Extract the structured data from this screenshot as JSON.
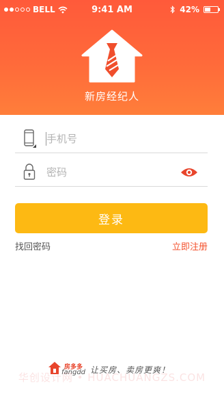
{
  "status_bar": {
    "carrier": "BELL",
    "time": "9:41 AM",
    "battery": "42%",
    "battery_level": 0.42,
    "signal_bars_filled": 2,
    "signal_bars_total": 5,
    "icons": [
      "wifi-icon",
      "bluetooth-icon",
      "battery-icon"
    ]
  },
  "header": {
    "app_name": "新房经纪人",
    "logo_icon": "house-tie-icon",
    "gradient_colors": [
      "#ff5a3a",
      "#ff7e3a"
    ]
  },
  "form": {
    "phone": {
      "placeholder": "手机号",
      "value": "",
      "icon": "mobile-phone-icon"
    },
    "password": {
      "placeholder": "密码",
      "value": "",
      "icon": "lock-icon",
      "toggle_icon": "eye-icon"
    },
    "login_label": "登录",
    "login_color": "#fdb913",
    "forgot_label": "找回密码",
    "register_label": "立即注册",
    "register_color": "#f4522d"
  },
  "footer": {
    "brand_cn": "房多多",
    "brand_en": "fangdd",
    "slogan": "让买房、卖房更爽！",
    "logo_icon": "house-logo-icon"
  },
  "watermark": "华创设计网 • HUACHUANGZS.COM"
}
